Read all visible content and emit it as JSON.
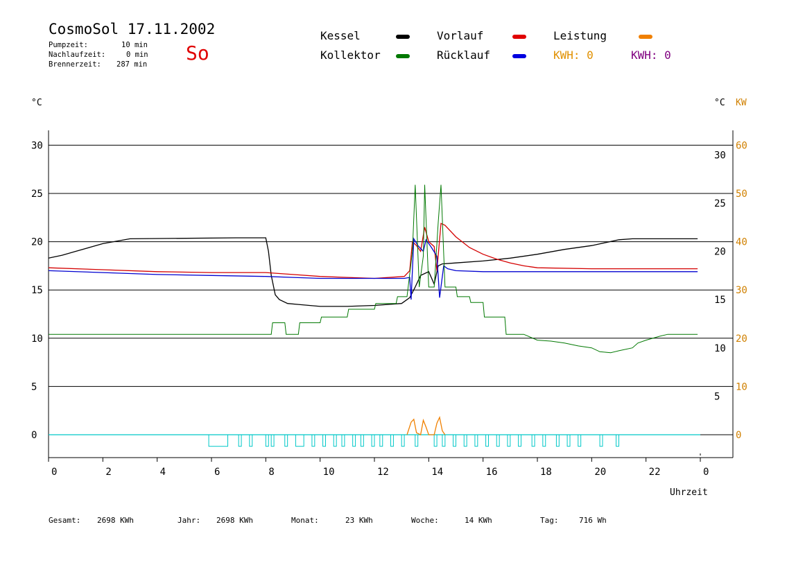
{
  "header": {
    "title": "CosmoSol 17.11.2002",
    "pumpzeit_label": "Pumpzeit:",
    "pumpzeit_value": "10 min",
    "nachlaufzeit_label": "Nachlaufzeit:",
    "nachlaufzeit_value": "0 min",
    "brennerzeit_label": "Brennerzeit:",
    "brennerzeit_value": "287 min",
    "weekday": "So"
  },
  "legend": {
    "kessel": "Kessel",
    "kollektor": "Kollektor",
    "vorlauf": "Vorlauf",
    "ruecklauf": "Rücklauf",
    "leistung": "Leistung",
    "kwh_orange": "KWH: 0",
    "kwh_purple": "KWH: 0"
  },
  "axes": {
    "left_unit": "°C",
    "right_unit": "°C",
    "right_unit2": "KW",
    "xlabel": "Uhrzeit"
  },
  "colors": {
    "kessel": "#000000",
    "kollektor": "#007800",
    "vorlauf": "#d40000",
    "ruecklauf": "#0000d0",
    "leistung": "#f08000",
    "kwh_purple": "#800080",
    "pumpe": "#00c8c8",
    "kw_axis": "#d08000"
  },
  "footer": {
    "gesamt_label": "Gesamt:",
    "gesamt_value": "2698 KWh",
    "jahr_label": "Jahr:",
    "jahr_value": "2698 KWh",
    "monat_label": "Monat:",
    "monat_value": "23 KWh",
    "woche_label": "Woche:",
    "woche_value": "14 KWh",
    "tag_label": "Tag:",
    "tag_value": "716 Wh"
  },
  "chart_data": {
    "type": "line",
    "xlabel": "Uhrzeit",
    "xlim": [
      0,
      24
    ],
    "ylim": [
      -2.5,
      32
    ],
    "grid": true,
    "x_ticks": [
      0,
      2,
      4,
      6,
      8,
      10,
      12,
      14,
      16,
      18,
      20,
      22,
      24
    ],
    "x_tick_labels": [
      "0",
      "2",
      "4",
      "6",
      "8",
      "10",
      "12",
      "14",
      "16",
      "18",
      "20",
      "22",
      "0"
    ],
    "y_ticks": [
      0,
      5,
      10,
      15,
      20,
      25,
      30
    ],
    "y_tick_labels_left": [
      "0",
      "5",
      "10",
      "15",
      "20",
      "25",
      "30"
    ],
    "y_tick_labels_right": [
      "5",
      "10",
      "15",
      "20",
      "25",
      "30"
    ],
    "y_ticks_right_values": [
      5,
      10,
      15,
      20,
      25,
      30
    ],
    "y2_tick_labels": [
      "0",
      "10",
      "20",
      "30",
      "40",
      "50",
      "60"
    ],
    "series": [
      {
        "name": "Kessel",
        "color": "#000000",
        "x": [
          0,
          0.5,
          1,
          2,
          3,
          6.9,
          8.0,
          8.1,
          8.2,
          8.35,
          8.5,
          8.8,
          9.2,
          10,
          11,
          12,
          13.0,
          13.3,
          13.5,
          13.7,
          14.0,
          14.2,
          14.35,
          14.5,
          15,
          16,
          17,
          18,
          19,
          20,
          21,
          21.5,
          23.9
        ],
        "y": [
          18.3,
          18.6,
          19.0,
          19.8,
          20.3,
          20.4,
          20.4,
          19.0,
          16.5,
          14.5,
          14.0,
          13.6,
          13.5,
          13.3,
          13.3,
          13.4,
          13.6,
          14.2,
          15.3,
          16.5,
          16.9,
          15.6,
          17.5,
          17.7,
          17.8,
          18.0,
          18.3,
          18.7,
          19.2,
          19.6,
          20.2,
          20.3,
          20.3
        ]
      },
      {
        "name": "Vorlauf",
        "color": "#d40000",
        "x": [
          0,
          2,
          4,
          6,
          8,
          9,
          10,
          11,
          12,
          13.1,
          13.3,
          13.4,
          13.55,
          13.7,
          13.85,
          14.0,
          14.2,
          14.3,
          14.45,
          14.6,
          15,
          15.5,
          16,
          16.5,
          17,
          17.5,
          18,
          20,
          22,
          23.9
        ],
        "y": [
          17.3,
          17.1,
          16.9,
          16.8,
          16.8,
          16.6,
          16.4,
          16.3,
          16.2,
          16.4,
          17.0,
          20.0,
          19.6,
          19.0,
          21.5,
          20.0,
          19.5,
          17.0,
          21.9,
          21.7,
          20.5,
          19.4,
          18.7,
          18.2,
          17.8,
          17.5,
          17.3,
          17.2,
          17.2,
          17.2
        ]
      },
      {
        "name": "Rücklauf",
        "color": "#0000d0",
        "x": [
          0,
          2,
          4,
          6,
          8,
          9,
          10,
          11,
          12,
          13.1,
          13.3,
          13.35,
          13.45,
          13.6,
          13.8,
          13.9,
          14.1,
          14.3,
          14.4,
          14.55,
          14.7,
          15,
          16,
          18,
          20,
          22,
          23.9
        ],
        "y": [
          17.0,
          16.8,
          16.6,
          16.5,
          16.4,
          16.3,
          16.2,
          16.2,
          16.2,
          16.2,
          16.3,
          14.0,
          20.3,
          19.6,
          19.0,
          20.2,
          19.4,
          18.5,
          14.2,
          17.5,
          17.2,
          17.0,
          16.9,
          16.9,
          16.9,
          16.9,
          16.9
        ]
      },
      {
        "name": "Kollektor",
        "color": "#007800",
        "x": [
          0,
          8.2,
          8.25,
          8.7,
          8.75,
          9.2,
          9.25,
          10.0,
          10.05,
          11.0,
          11.05,
          12.0,
          12.05,
          12.8,
          12.85,
          13.2,
          13.4,
          13.5,
          13.65,
          13.8,
          13.85,
          14.0,
          14.2,
          14.35,
          14.45,
          14.6,
          15.0,
          15.05,
          15.5,
          15.55,
          16.0,
          16.05,
          16.8,
          16.85,
          17.5,
          18,
          18.5,
          19,
          19.5,
          20,
          20.3,
          20.7,
          21,
          21.5,
          21.7,
          22,
          22.5,
          22.8,
          23.9
        ],
        "y": [
          10.4,
          10.4,
          11.6,
          11.6,
          10.4,
          10.4,
          11.6,
          11.6,
          12.2,
          12.2,
          13.0,
          13.0,
          13.6,
          13.6,
          14.3,
          14.3,
          19.0,
          25.9,
          15.3,
          18.5,
          25.9,
          15.3,
          15.3,
          22.0,
          25.9,
          15.3,
          15.3,
          14.3,
          14.3,
          13.7,
          13.7,
          12.2,
          12.2,
          10.4,
          10.4,
          9.8,
          9.7,
          9.5,
          9.2,
          9.0,
          8.6,
          8.5,
          8.7,
          9.0,
          9.5,
          9.8,
          10.2,
          10.4,
          10.4
        ]
      },
      {
        "name": "Leistung",
        "color": "#f08000",
        "x": [
          13.2,
          13.35,
          13.45,
          13.55,
          13.7,
          13.8,
          13.9,
          14.0,
          14.2,
          14.3,
          14.4,
          14.5,
          14.6
        ],
        "y": [
          0.0,
          1.3,
          1.6,
          0.2,
          0.0,
          1.5,
          0.8,
          0.0,
          0.0,
          1.2,
          1.8,
          0.4,
          0.0
        ]
      }
    ],
    "pump_pulses": {
      "color": "#00c8c8",
      "height": -1.2,
      "intervals": [
        [
          5.9,
          6.6
        ],
        [
          7.0,
          7.1
        ],
        [
          7.4,
          7.5
        ],
        [
          8.0,
          8.1
        ],
        [
          8.2,
          8.3
        ],
        [
          8.7,
          8.8
        ],
        [
          9.1,
          9.4
        ],
        [
          9.7,
          9.8
        ],
        [
          10.1,
          10.2
        ],
        [
          10.5,
          10.6
        ],
        [
          10.8,
          10.9
        ],
        [
          11.2,
          11.3
        ],
        [
          11.5,
          11.6
        ],
        [
          11.9,
          12.0
        ],
        [
          12.2,
          12.3
        ],
        [
          12.6,
          12.7
        ],
        [
          13.0,
          13.1
        ],
        [
          13.5,
          13.6
        ],
        [
          14.2,
          14.3
        ],
        [
          14.5,
          14.6
        ],
        [
          14.9,
          15.0
        ],
        [
          15.3,
          15.4
        ],
        [
          15.7,
          15.8
        ],
        [
          16.1,
          16.2
        ],
        [
          16.5,
          16.6
        ],
        [
          16.9,
          17.0
        ],
        [
          17.3,
          17.4
        ],
        [
          17.8,
          17.9
        ],
        [
          18.2,
          18.3
        ],
        [
          18.7,
          18.8
        ],
        [
          19.1,
          19.2
        ],
        [
          19.5,
          19.6
        ],
        [
          20.3,
          20.4
        ],
        [
          20.9,
          21.0
        ]
      ]
    }
  }
}
